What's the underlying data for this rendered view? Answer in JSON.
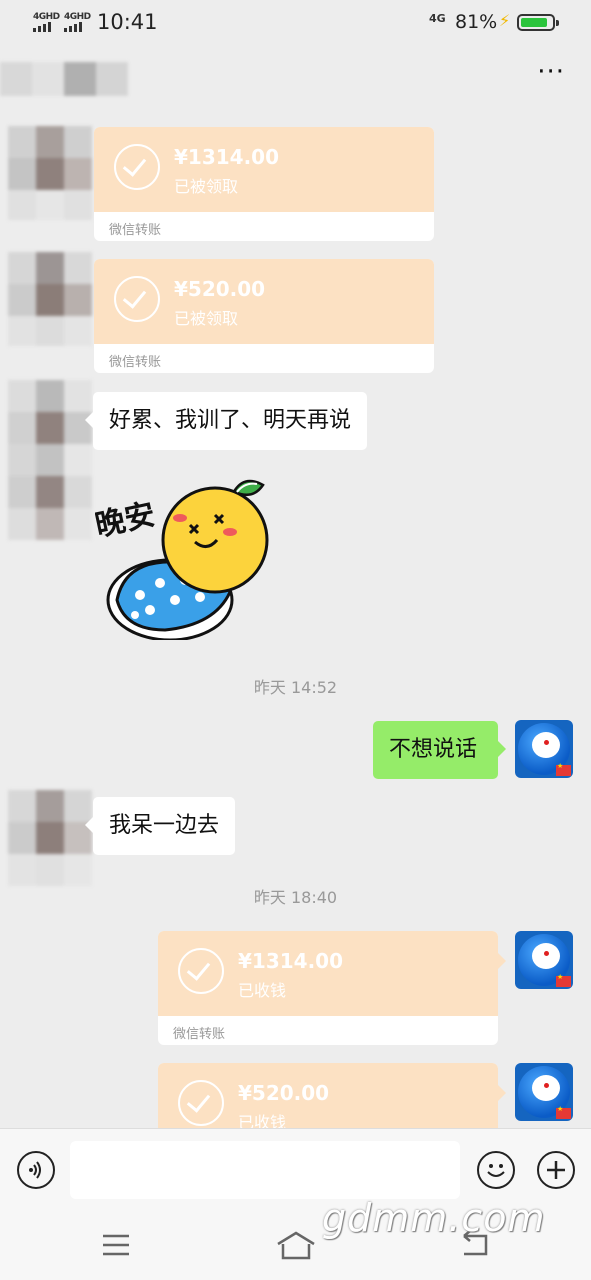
{
  "status": {
    "sig1": "4GHD",
    "sig2": "4GHD",
    "time": "10:41",
    "net": "4G",
    "battery": "81%",
    "battery_level": 0.81
  },
  "header": {
    "more": "···"
  },
  "messages": {
    "t1": {
      "amount": "¥1314.00",
      "status": "已被领取",
      "footer": "微信转账"
    },
    "t2": {
      "amount": "¥520.00",
      "status": "已被领取",
      "footer": "微信转账"
    },
    "m1": "好累、我训了、明天再说",
    "sticker": "晚安",
    "ts1": "昨天 14:52",
    "m2": "不想说话",
    "m3": "我呆一边去",
    "ts2": "昨天 18:40",
    "t3": {
      "amount": "¥1314.00",
      "status": "已收钱",
      "footer": "微信转账"
    },
    "t4": {
      "amount": "¥520.00",
      "status": "已收钱"
    }
  },
  "watermark": "gdmm.com",
  "colors": {
    "bubble_green": "#95ec69",
    "transfer_orange": "#fce1c3",
    "background": "#ededed"
  },
  "icons": [
    "voice-icon",
    "emoji-icon",
    "plus-icon",
    "menu-icon",
    "home-icon",
    "back-icon",
    "check-icon"
  ]
}
